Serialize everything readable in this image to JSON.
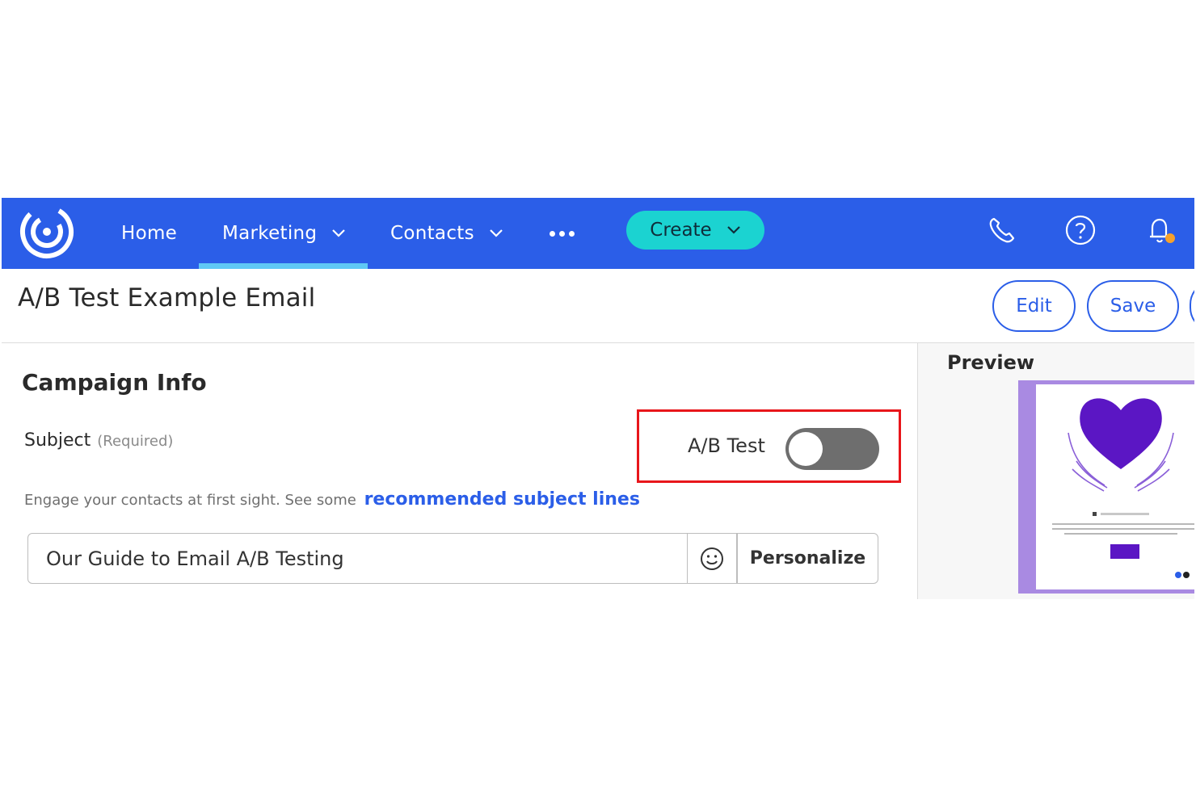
{
  "nav": {
    "home": "Home",
    "marketing": "Marketing",
    "contacts": "Contacts",
    "create": "Create"
  },
  "header": {
    "title": "A/B Test Example Email",
    "edit": "Edit",
    "save": "Save"
  },
  "campaign": {
    "section_title": "Campaign Info",
    "subject_label": "Subject",
    "subject_required": "(Required)",
    "ab_test_label": "A/B Test",
    "ab_test_enabled": false,
    "helper_text": "Engage your contacts at first sight. See some",
    "helper_link": "recommended subject lines",
    "subject_value": "Our Guide to Email A/B Testing",
    "personalize": "Personalize"
  },
  "preview": {
    "title": "Preview"
  },
  "colors": {
    "nav_bg": "#2b5ee8",
    "accent_teal": "#1bd3d1",
    "highlight_red": "#e8161b",
    "preview_purple": "#a98ae2",
    "heart_purple": "#5b16c4"
  }
}
